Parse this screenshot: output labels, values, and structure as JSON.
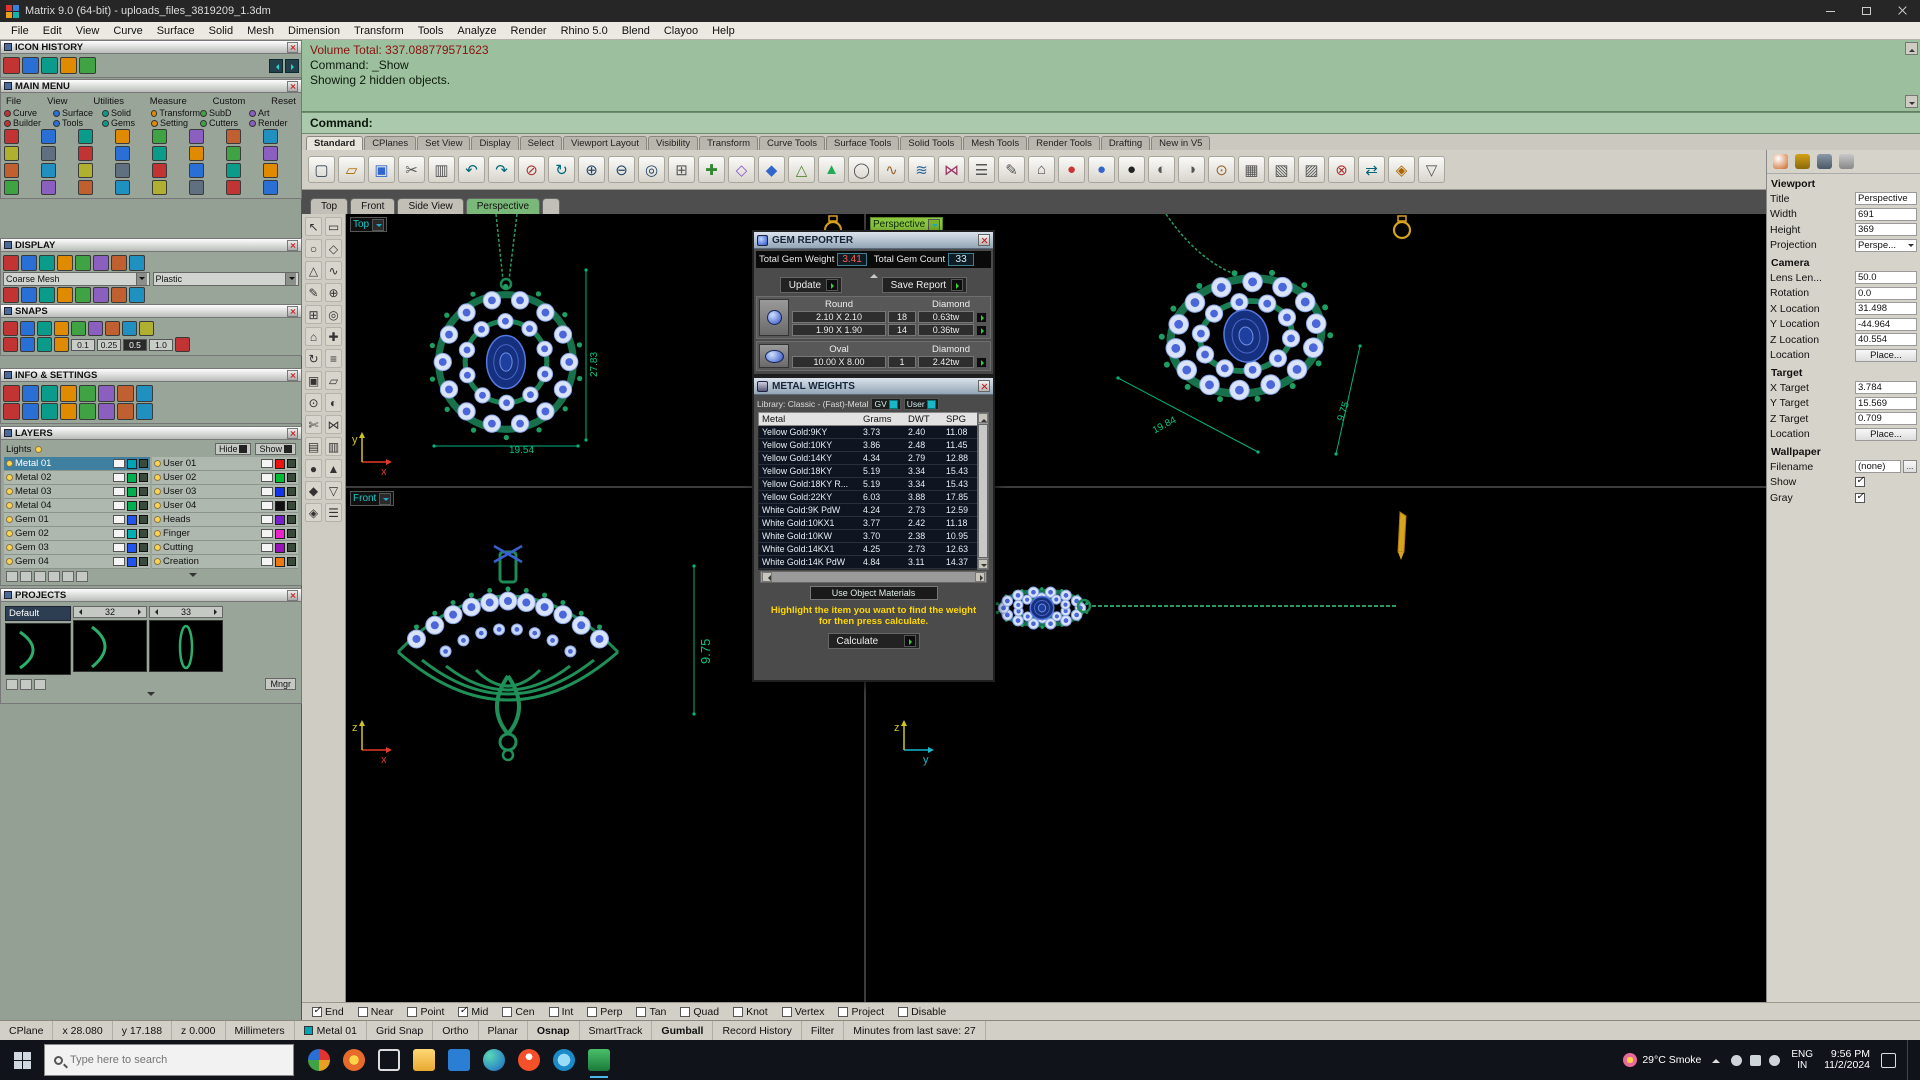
{
  "titlebar": {
    "title": "Matrix 9.0 (64-bit) - uploads_files_3819209_1.3dm"
  },
  "menubar": [
    "File",
    "Edit",
    "View",
    "Curve",
    "Surface",
    "Solid",
    "Mesh",
    "Dimension",
    "Transform",
    "Tools",
    "Analyze",
    "Render",
    "Rhino 5.0",
    "Blend",
    "Clayoo",
    "Help"
  ],
  "command": {
    "history": [
      {
        "text": "Volume Total: 337.088779571623",
        "accent": true
      },
      {
        "text": "Command: _Show",
        "accent": false
      },
      {
        "text": "Showing 2 hidden objects.",
        "accent": false
      }
    ],
    "prompt": "Command:"
  },
  "ribbon": {
    "active": "Standard",
    "tabs": [
      "Standard",
      "CPlanes",
      "Set View",
      "Display",
      "Select",
      "Viewport Layout",
      "Visibility",
      "Transform",
      "Curve Tools",
      "Surface Tools",
      "Solid Tools",
      "Mesh Tools",
      "Render Tools",
      "Drafting",
      "New in V5"
    ]
  },
  "sidebar": {
    "icon_history": {
      "title": "ICON HISTORY"
    },
    "main_menu": {
      "title": "MAIN MENU",
      "menu_words": [
        "File",
        "View",
        "Utilities",
        "Measure",
        "Custom",
        "Reset"
      ],
      "row1": [
        "Curve",
        "Surface",
        "Solid",
        "Transform",
        "SubD",
        "Art"
      ],
      "row2": [
        "Builder",
        "Tools",
        "Gems",
        "Setting",
        "Cutters",
        "Render"
      ]
    },
    "display": {
      "title": "DISPLAY",
      "mesh": "Coarse Mesh",
      "material": "Plastic"
    },
    "snaps": {
      "title": "SNAPS",
      "values": [
        "0.1",
        "0.25",
        "0.5",
        "1.0"
      ],
      "active": "0.5"
    },
    "info": {
      "title": "INFO & SETTINGS"
    },
    "layers": {
      "title": "LAYERS",
      "lights": "Lights",
      "hide": "Hide",
      "show": "Show",
      "left": [
        {
          "name": "Metal 01",
          "color": "#00a5b5",
          "sel": true
        },
        {
          "name": "Metal 02",
          "color": "#00b050",
          "sel": false
        },
        {
          "name": "Metal 03",
          "color": "#00b050",
          "sel": false
        },
        {
          "name": "Metal 04",
          "color": "#00b050",
          "sel": false
        },
        {
          "name": "Gem 01",
          "color": "#2255ee",
          "sel": false
        },
        {
          "name": "Gem 02",
          "color": "#00b0b0",
          "sel": false
        },
        {
          "name": "Gem 03",
          "color": "#2255ee",
          "sel": false
        },
        {
          "name": "Gem 04",
          "color": "#2255ee",
          "sel": false
        }
      ],
      "right": [
        {
          "name": "User 01",
          "color": "#ee1111"
        },
        {
          "name": "User 02",
          "color": "#00bb33"
        },
        {
          "name": "User 03",
          "color": "#1133ee"
        },
        {
          "name": "User 04",
          "color": "#111111"
        },
        {
          "name": "Heads",
          "color": "#7722cc"
        },
        {
          "name": "Finger",
          "color": "#ee22cc"
        },
        {
          "name": "Cutting",
          "color": "#9911bb"
        },
        {
          "name": "Creation",
          "color": "#ee7711"
        }
      ]
    },
    "projects": {
      "title": "PROJECTS",
      "default_item": "Default",
      "thumb_a": "32",
      "thumb_b": "33",
      "mngr": "Mngr"
    }
  },
  "viewport_tabs": {
    "tabs": [
      "Top",
      "Front",
      "Side View",
      "Perspective"
    ],
    "active": "Perspective"
  },
  "viewports": {
    "top": {
      "label": "Top",
      "dims": [
        "27.83",
        "19.54"
      ],
      "axis_up": "y",
      "axis_right": "x"
    },
    "persp": {
      "label": "Perspective",
      "dims": [
        "19.84",
        "9.75"
      ]
    },
    "front": {
      "label": "Front",
      "dims": [
        "9.75"
      ],
      "axis_up": "z",
      "axis_right": "x"
    },
    "side": {
      "axis_up": "z",
      "axis_right": "y"
    }
  },
  "gem_reporter": {
    "title": "GEM REPORTER",
    "w_label": "Total Gem Weight",
    "w_value": "3.41",
    "c_label": "Total Gem Count",
    "c_value": "33",
    "update": "Update",
    "save": "Save Report",
    "groups": [
      {
        "shape": "Round",
        "type": "Diamond",
        "stone": "round",
        "rows": [
          [
            "2.10 X 2.10",
            "18",
            "0.63tw"
          ],
          [
            "1.90 X 1.90",
            "14",
            "0.36tw"
          ]
        ]
      },
      {
        "shape": "Oval",
        "type": "Diamond",
        "stone": "oval",
        "rows": [
          [
            "10.00 X 8.00",
            "1",
            "2.42tw"
          ]
        ]
      }
    ]
  },
  "metal_weights": {
    "title": "METAL WEIGHTS",
    "library": "Library: Classic - (Fast)-Metal",
    "gv": "GV",
    "user": "User",
    "columns": [
      "Metal",
      "Grams",
      "DWT",
      "SPG"
    ],
    "rows": [
      [
        "Yellow Gold:9KY",
        "3.73",
        "2.40",
        "11.08"
      ],
      [
        "Yellow Gold:10KY",
        "3.86",
        "2.48",
        "11.45"
      ],
      [
        "Yellow Gold:14KY",
        "4.34",
        "2.79",
        "12.88"
      ],
      [
        "Yellow Gold:18KY",
        "5.19",
        "3.34",
        "15.43"
      ],
      [
        "Yellow Gold:18KY R...",
        "5.19",
        "3.34",
        "15.43"
      ],
      [
        "Yellow Gold:22KY",
        "6.03",
        "3.88",
        "17.85"
      ],
      [
        "White Gold:9K PdW",
        "4.24",
        "2.73",
        "12.59"
      ],
      [
        "White Gold:10KX1",
        "3.77",
        "2.42",
        "11.18"
      ],
      [
        "White Gold:10KW",
        "3.70",
        "2.38",
        "10.95"
      ],
      [
        "White Gold:14KX1",
        "4.25",
        "2.73",
        "12.63"
      ],
      [
        "White Gold:14K PdW",
        "4.84",
        "3.11",
        "14.37"
      ]
    ],
    "use_materials": "Use Object Materials",
    "hint": [
      "Highlight the item you want to find the weight",
      "for then press calculate."
    ],
    "calculate": "Calculate"
  },
  "properties": {
    "sections": [
      {
        "title": "Viewport",
        "rows": [
          [
            "Title",
            "Perspective",
            "text"
          ],
          [
            "Width",
            "691",
            "text"
          ],
          [
            "Height",
            "369",
            "text"
          ],
          [
            "Projection",
            "Perspe...",
            "drop"
          ]
        ]
      },
      {
        "title": "Camera",
        "rows": [
          [
            "Lens Len...",
            "50.0",
            "text"
          ],
          [
            "Rotation",
            "0.0",
            "text"
          ],
          [
            "X Location",
            "31.498",
            "text"
          ],
          [
            "Y Location",
            "-44.964",
            "text"
          ],
          [
            "Z Location",
            "40.554",
            "text"
          ],
          [
            "Location",
            "Place...",
            "btn"
          ]
        ]
      },
      {
        "title": "Target",
        "rows": [
          [
            "X Target",
            "3.784",
            "text"
          ],
          [
            "Y Target",
            "15.569",
            "text"
          ],
          [
            "Z Target",
            "0.709",
            "text"
          ],
          [
            "Location",
            "Place...",
            "btn"
          ]
        ]
      },
      {
        "title": "Wallpaper",
        "rows": [
          [
            "Filename",
            "(none)",
            "file"
          ],
          [
            "Show",
            "",
            "check"
          ],
          [
            "Gray",
            "",
            "check"
          ]
        ]
      }
    ]
  },
  "osnap": [
    {
      "label": "End",
      "on": true
    },
    {
      "label": "Near",
      "on": false
    },
    {
      "label": "Point",
      "on": false
    },
    {
      "label": "Mid",
      "on": true
    },
    {
      "label": "Cen",
      "on": false
    },
    {
      "label": "Int",
      "on": false
    },
    {
      "label": "Perp",
      "on": false
    },
    {
      "label": "Tan",
      "on": false
    },
    {
      "label": "Quad",
      "on": false
    },
    {
      "label": "Knot",
      "on": false
    },
    {
      "label": "Vertex",
      "on": false
    },
    {
      "label": "Project",
      "on": false
    },
    {
      "label": "Disable",
      "on": false
    }
  ],
  "statusbar": [
    {
      "t": "CPlane"
    },
    {
      "t": "x 28.080"
    },
    {
      "t": "y 17.188"
    },
    {
      "t": "z 0.000"
    },
    {
      "t": "Millimeters"
    },
    {
      "t": "Metal 01",
      "swatch": "#00a5b5"
    },
    {
      "t": "Grid Snap"
    },
    {
      "t": "Ortho"
    },
    {
      "t": "Planar"
    },
    {
      "t": "Osnap",
      "bold": true
    },
    {
      "t": "SmartTrack"
    },
    {
      "t": "Gumball",
      "bold": true
    },
    {
      "t": "Record History"
    },
    {
      "t": "Filter"
    },
    {
      "t": "Minutes from last save: 27"
    }
  ],
  "taskbar": {
    "search": "Type here to search",
    "weather": "29°C Smoke",
    "lang_top": "ENG",
    "lang_bottom": "IN",
    "time": "9:56 PM",
    "date": "11/2/2024"
  },
  "colors": {
    "metal_green": "#1d8a55",
    "gem_blue": "#14307e",
    "dim_green": "#00b47e",
    "accent_teal": "#19b8c8"
  }
}
